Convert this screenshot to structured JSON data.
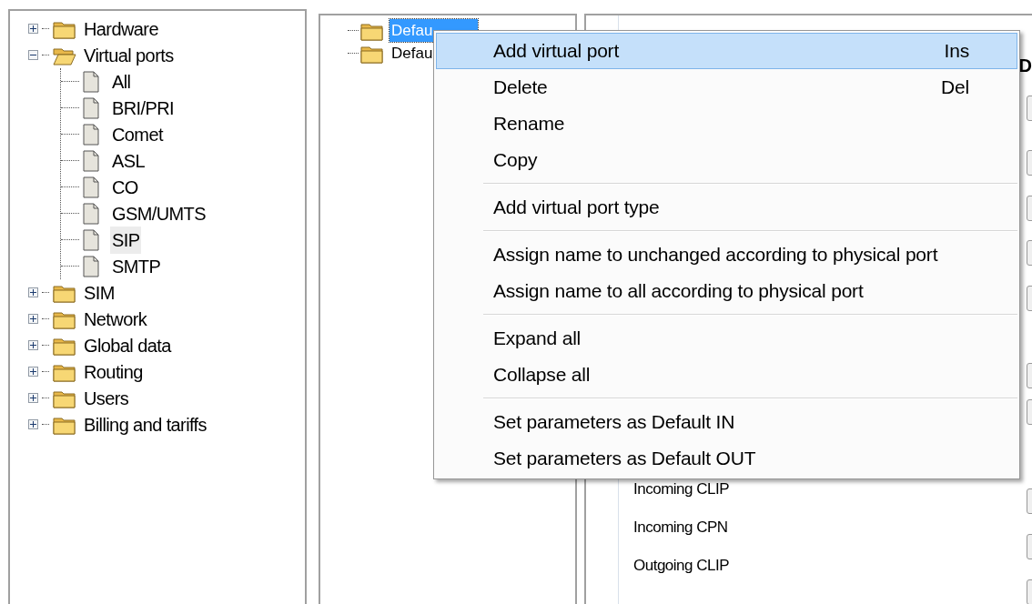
{
  "nav_tree": [
    {
      "label": "Hardware",
      "kind": "folder",
      "expanded": false,
      "selected": false
    },
    {
      "label": "Virtual ports",
      "kind": "folder",
      "expanded": true,
      "selected": false,
      "children": [
        {
          "label": "All",
          "kind": "document",
          "selected": false
        },
        {
          "label": "BRI/PRI",
          "kind": "document",
          "selected": false
        },
        {
          "label": "Comet",
          "kind": "document",
          "selected": false
        },
        {
          "label": "ASL",
          "kind": "document",
          "selected": false
        },
        {
          "label": "CO",
          "kind": "document",
          "selected": false
        },
        {
          "label": "GSM/UMTS",
          "kind": "document",
          "selected": false
        },
        {
          "label": "SIP",
          "kind": "document",
          "selected": true
        },
        {
          "label": "SMTP",
          "kind": "document",
          "selected": false
        }
      ]
    },
    {
      "label": "SIM",
      "kind": "folder",
      "expanded": false,
      "selected": false
    },
    {
      "label": "Network",
      "kind": "folder",
      "expanded": false,
      "selected": false
    },
    {
      "label": "Global data",
      "kind": "folder",
      "expanded": false,
      "selected": false
    },
    {
      "label": "Routing",
      "kind": "folder",
      "expanded": false,
      "selected": false
    },
    {
      "label": "Users",
      "kind": "folder",
      "expanded": false,
      "selected": false
    },
    {
      "label": "Billing and tariffs",
      "kind": "folder",
      "expanded": false,
      "selected": false
    }
  ],
  "port_tree": [
    {
      "label": "Defau",
      "selected": true
    },
    {
      "label": "Defau",
      "selected": false
    }
  ],
  "details": {
    "heading": "D",
    "fields": [
      "Incoming CLIP",
      "Incoming CPN",
      "Outgoing CLIP"
    ]
  },
  "context_menu": {
    "groups": [
      [
        {
          "label": "Add virtual port",
          "shortcut": "Ins",
          "selected": true
        },
        {
          "label": "Delete",
          "shortcut": "Del",
          "selected": false
        },
        {
          "label": "Rename",
          "selected": false
        },
        {
          "label": "Copy",
          "selected": false
        }
      ],
      [
        {
          "label": "Add virtual port type",
          "selected": false
        }
      ],
      [
        {
          "label": "Assign name to unchanged according to physical port",
          "selected": false
        },
        {
          "label": "Assign name to all according to physical port",
          "selected": false
        }
      ],
      [
        {
          "label": "Expand all",
          "selected": false
        },
        {
          "label": "Collapse all",
          "selected": false
        }
      ],
      [
        {
          "label": "Set parameters as Default IN",
          "selected": false
        },
        {
          "label": "Set parameters as Default OUT",
          "selected": false
        }
      ]
    ]
  }
}
